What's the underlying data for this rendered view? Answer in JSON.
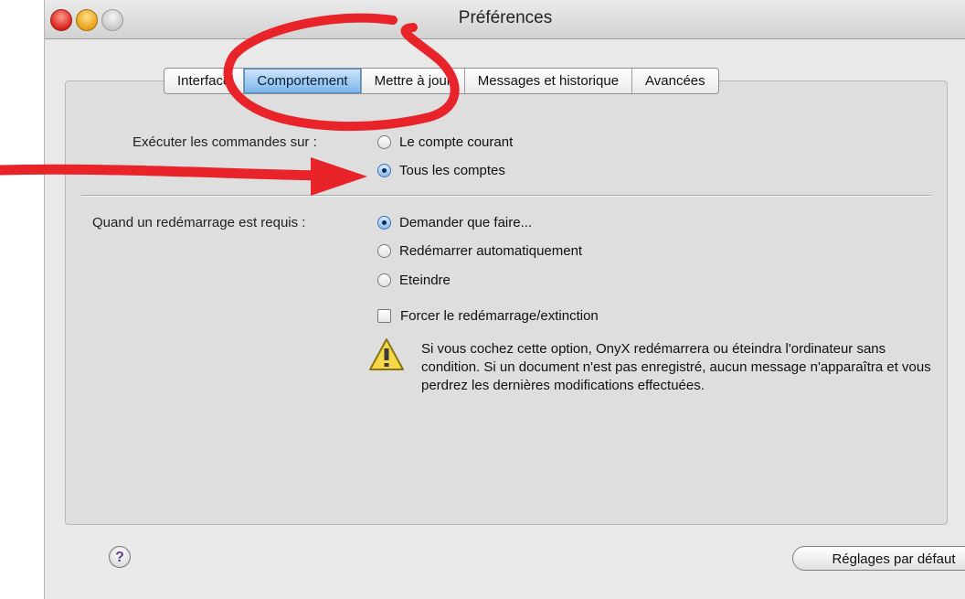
{
  "window": {
    "title": "Préférences"
  },
  "tabs": [
    {
      "label": "Interface"
    },
    {
      "label": "Comportement",
      "selected": true
    },
    {
      "label": "Mettre à jour"
    },
    {
      "label": "Messages et historique"
    },
    {
      "label": "Avancées"
    }
  ],
  "execute": {
    "label": "Exécuter les commandes sur :",
    "options": [
      {
        "label": "Le compte courant",
        "selected": false
      },
      {
        "label": "Tous les comptes",
        "selected": true
      }
    ]
  },
  "restart": {
    "label": "Quand un redémarrage est requis :",
    "options": [
      {
        "label": "Demander que faire...",
        "selected": true
      },
      {
        "label": "Redémarrer automatiquement",
        "selected": false
      },
      {
        "label": "Eteindre",
        "selected": false
      }
    ],
    "force": {
      "label": "Forcer le redémarrage/extinction",
      "checked": false
    }
  },
  "warning": {
    "icon": "warning-icon",
    "text": "Si vous cochez cette option, OnyX redémarrera ou éteindra l'ordinateur sans condition. Si un document n'est pas enregistré, aucun message n'apparaîtra et vous perdrez les dernières modifications effectuées."
  },
  "footer": {
    "help_icon": "help-icon",
    "help_symbol": "?",
    "defaults_button": "Réglages par défaut"
  },
  "annotations": {
    "color": "#e8232a"
  }
}
